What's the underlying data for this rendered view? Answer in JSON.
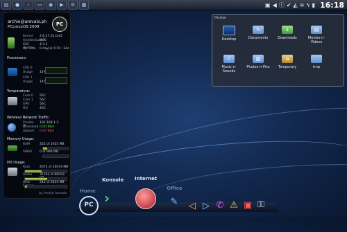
{
  "panel": {
    "left_icons": [
      "menu-icon",
      "pclinuxos-icon",
      "konsole-icon",
      "folder-icon",
      "browser-icon",
      "media-icon",
      "settings-icon",
      "desktop-icon"
    ],
    "clock": "16:18"
  },
  "widget": {
    "user": "archie@arevalo.ph",
    "os": "PCLinuxOS 2009",
    "logo_text": "PC",
    "system": [
      {
        "k": "Kernel",
        "v": "2.6.27.31.tex5"
      },
      {
        "k": "Architecture",
        "v": "i686"
      },
      {
        "k": "KDE Version",
        "v": "4.3.1"
      },
      {
        "k": "Up Time",
        "v": "0 day(s) 0:19 : 34s"
      }
    ],
    "processors_title": "Processors:",
    "cpus": [
      {
        "k": "CPU 0",
        "v": ""
      },
      {
        "k": "Usage",
        "v": "14%"
      },
      {
        "k": "CPU 1",
        "v": ""
      },
      {
        "k": "Usage",
        "v": "14%"
      }
    ],
    "temperature_title": "Temperature:",
    "temps": [
      {
        "k": "Core 0",
        "v": "56C"
      },
      {
        "k": "Core 1",
        "v": "56C"
      },
      {
        "k": "GPU",
        "v": "56C"
      },
      {
        "k": "HD",
        "v": "40C"
      }
    ],
    "network_title": "Wireless Network Traffic:",
    "net": [
      {
        "k": "Private IP",
        "v": "192.168.1.3"
      },
      {
        "k": "Download",
        "v": "0.00 KB/s"
      },
      {
        "k": "Upload",
        "v": "0.00 KB/s"
      }
    ],
    "memory_title": "Memory Usage:",
    "mem": [
      {
        "k": "RAM",
        "v": "352 of 2025 MB",
        "fraction": 0.17
      },
      {
        "k": "SWAP",
        "v": "0 of 996 MB",
        "fraction": 0.0
      }
    ],
    "hd_title": "HD Usage:",
    "hd": [
      {
        "k": "Root",
        "v": "4072 of 10074 MB",
        "fraction": 0.4
      },
      {
        "k": "Home",
        "v": "35762 of 66593 MB",
        "fraction": 0.54
      },
      {
        "k": "Web Server",
        "v": "242 of 5034 MB",
        "fraction": 0.05
      }
    ],
    "author": "by Archie Arevalo"
  },
  "home": {
    "title": "Home",
    "items": [
      {
        "label": "Desktop",
        "icon": "desktop-icon"
      },
      {
        "label": "Documents",
        "icon": "documents-icon"
      },
      {
        "label": "Downloads",
        "icon": "downloads-icon"
      },
      {
        "label": "Movies-n-Videos",
        "icon": "video-icon"
      },
      {
        "label": "Music-n-Sounds",
        "icon": "music-icon"
      },
      {
        "label": "Photos-n-Pics",
        "icon": "photos-icon"
      },
      {
        "label": "Temporary",
        "icon": "temporary-icon"
      },
      {
        "label": "tmp",
        "icon": "folder-icon"
      }
    ]
  },
  "dock": {
    "labels": [
      {
        "label": "Konsole",
        "dim": false
      },
      {
        "label": "Internet",
        "dim": false
      },
      {
        "label": "Office",
        "dim": true
      },
      {
        "label": "Home",
        "dim": true
      }
    ],
    "icons": [
      "pclinuxos-icon",
      "konsole-icon",
      "internet-icon",
      "office-icon",
      "graphics-icon",
      "media-icon",
      "tools-icon",
      "warning-icon",
      "briefcase-icon",
      "lock-icon"
    ]
  }
}
